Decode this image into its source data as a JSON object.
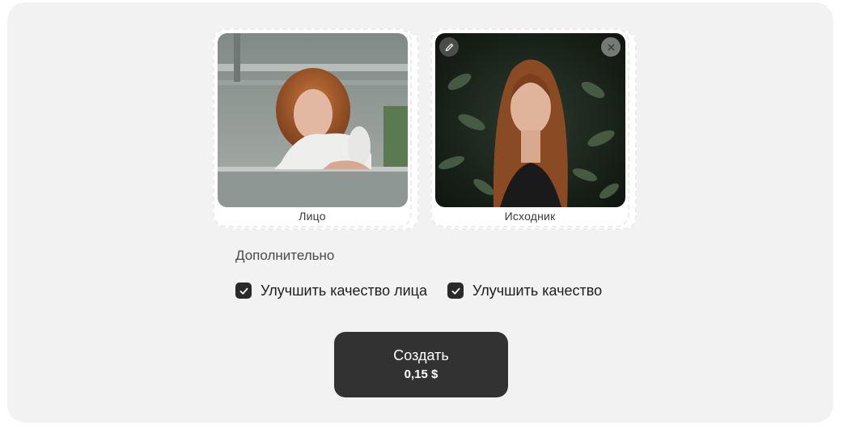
{
  "images": [
    {
      "label": "Лицо"
    },
    {
      "label": "Исходник"
    }
  ],
  "options": {
    "title": "Дополнительно",
    "items": [
      {
        "label": "Улучшить качество лица",
        "checked": true
      },
      {
        "label": "Улучшить качество",
        "checked": true
      }
    ]
  },
  "create": {
    "label": "Создать",
    "price": "0,15 $"
  },
  "colors": {
    "panel": "#f2f2f2",
    "button": "#323232",
    "checkbox": "#2a2a2a"
  }
}
